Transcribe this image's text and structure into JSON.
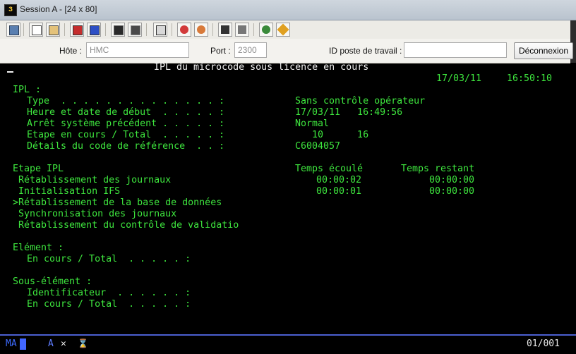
{
  "window": {
    "title": "Session A - [24 x 80]",
    "app_icon": "terminal-app-icon"
  },
  "toolbar": {
    "buttons": [
      "print-screen-icon",
      "copy-icon",
      "paste-icon",
      "send-icon",
      "receive-icon",
      "display-icon",
      "keyboard-icon",
      "record-macro-icon",
      "play-macro-icon",
      "macro-icon",
      "macro-list-icon",
      "globe-icon",
      "settings-icon"
    ]
  },
  "connection": {
    "host_label": "Hôte :",
    "host_value": "HMC",
    "port_label": "Port :",
    "port_value": "2300",
    "workstation_label": "ID poste de travail :",
    "workstation_value": "",
    "disconnect_label": "Déconnexion"
  },
  "screen": {
    "title": "IPL du microcode sous licence en cours",
    "date": "17/03/11",
    "time": "16:50:10",
    "ipl_header": "IPL :",
    "fields": [
      {
        "label": "Type  . . . . . . . . . . . . . . :",
        "value": "Sans contrôle opérateur"
      },
      {
        "label": "Heure et date de début  . . . . . :",
        "value": "17/03/11   16:49:56"
      },
      {
        "label": "Arrêt système précédent . . . . . :",
        "value": "Normal"
      },
      {
        "label": "Etape en cours / Total  . . . . . :",
        "value": "   10      16"
      },
      {
        "label": "Détails du code de référence  . . :",
        "value": "C6004057"
      }
    ],
    "step_header": "Etape IPL",
    "elapsed_header": "Temps écoulé",
    "remaining_header": "Temps restant",
    "steps": [
      {
        "label": " Rétablissement des journaux",
        "elapsed": "00:00:02",
        "remaining": "00:00:00"
      },
      {
        "label": " Initialisation IFS",
        "elapsed": "00:00:01",
        "remaining": "00:00:00"
      },
      {
        "label": ">Rétablissement de la base de données",
        "elapsed": "",
        "remaining": ""
      },
      {
        "label": " Synchronisation des journaux",
        "elapsed": "",
        "remaining": ""
      },
      {
        "label": " Rétablissement du contrôle de validatio",
        "elapsed": "",
        "remaining": ""
      }
    ],
    "element_header": "Elément :",
    "element_in_progress": "En cours / Total  . . . . . :",
    "subelement_header": "Sous-élément :",
    "subelement_identifier": "Identificateur  . . . . . . :",
    "subelement_in_progress": "En cours / Total  . . . . . :"
  },
  "status": {
    "mode": "MA",
    "indicator_a": "A",
    "indicator_x": "✕",
    "indicator_wait": "⌛",
    "position": "01/001"
  },
  "colors": {
    "terminal_green": "#3ee63e",
    "status_blue": "#4166ff"
  }
}
